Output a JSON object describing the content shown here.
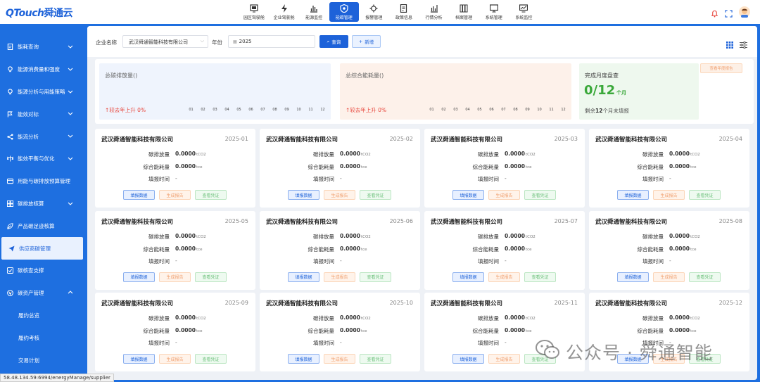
{
  "brand": {
    "logo_en": "QTouch",
    "logo_cn": "舜通云"
  },
  "nav": [
    {
      "label": "园区驾驶舱",
      "icon": "cockpit-icon"
    },
    {
      "label": "企业驾驶舱",
      "icon": "bolt-icon"
    },
    {
      "label": "能源监控",
      "icon": "bar-chart-icon"
    },
    {
      "label": "能碳管理",
      "icon": "carbon-shield-icon",
      "active": true
    },
    {
      "label": "报警管理",
      "icon": "alarm-gear-icon"
    },
    {
      "label": "政策信息",
      "icon": "document-edit-icon"
    },
    {
      "label": "行情分析",
      "icon": "market-chart-icon"
    },
    {
      "label": "档案管理",
      "icon": "archive-icon"
    },
    {
      "label": "系统管理",
      "icon": "monitor-icon"
    },
    {
      "label": "系统监控",
      "icon": "trend-monitor-icon"
    }
  ],
  "sidebar": [
    {
      "label": "能耗查询",
      "icon": "file-icon",
      "chevron": "down"
    },
    {
      "label": "能源消费量和强度",
      "icon": "bulb-icon",
      "chevron": "down"
    },
    {
      "label": "能源分析与用能策略",
      "icon": "bulb-icon",
      "chevron": "down"
    },
    {
      "label": "能效对标",
      "icon": "flag-icon",
      "chevron": "down"
    },
    {
      "label": "能流分析",
      "icon": "flow-icon",
      "chevron": "down"
    },
    {
      "label": "能效平衡与优化",
      "icon": "balance-icon",
      "chevron": "down"
    },
    {
      "label": "用能与碳排放预算管理",
      "icon": "budget-icon"
    },
    {
      "label": "碳排放核算",
      "icon": "grid-icon",
      "chevron": "down"
    },
    {
      "label": "产品碳足迹核算",
      "icon": "leaf-icon"
    },
    {
      "label": "供应商碳管理",
      "icon": "send-icon",
      "active": true
    },
    {
      "label": "碳核查支撑",
      "icon": "check-icon"
    },
    {
      "label": "碳资产管理",
      "icon": "asset-icon",
      "chevron": "up"
    },
    {
      "label": "履约总览",
      "sub": true
    },
    {
      "label": "履约考核",
      "sub": true
    },
    {
      "label": "交易计划",
      "sub": true
    }
  ],
  "filter": {
    "company_label": "企业名称",
    "company_value": "武汉舜通智能科技有限公司",
    "year_label": "年份",
    "year_value": "2025",
    "query_label": "查询",
    "add_label": "新增"
  },
  "summary": {
    "emission_title": "总碳排放量()",
    "emission_rise": "↑较去年上升 0%",
    "energy_title": "总综合能耗量()",
    "energy_rise": "↑较去年上升 0%",
    "months": [
      "01",
      "02",
      "03",
      "04",
      "05",
      "06",
      "07",
      "08",
      "09",
      "10",
      "11",
      "12"
    ],
    "month_progress_title": "完成月度盘查",
    "progress_value": "0/12",
    "progress_unit": "个月",
    "remaining_prefix": "剩余",
    "remaining_count": "12",
    "remaining_suffix": "个月未填报",
    "annual_report_button": "查看年度报告"
  },
  "card_labels": {
    "emission": "碳排放量",
    "energy": "综合能耗量",
    "report_time": "填报时间",
    "emission_unit": "tCO2",
    "energy_unit": "tce",
    "fill_button": "填报数据",
    "generate_button": "生成报告",
    "view_button": "查看凭证"
  },
  "cards": [
    {
      "company": "武汉舜通智能科技有限公司",
      "date": "2025-01",
      "emission": "0.0000",
      "energy": "0.0000",
      "report_time": "-"
    },
    {
      "company": "武汉舜通智能科技有限公司",
      "date": "2025-02",
      "emission": "0.0000",
      "energy": "0.0000",
      "report_time": "-"
    },
    {
      "company": "武汉舜通智能科技有限公司",
      "date": "2025-03",
      "emission": "0.0000",
      "energy": "0.0000",
      "report_time": "-"
    },
    {
      "company": "武汉舜通智能科技有限公司",
      "date": "2025-04",
      "emission": "0.0000",
      "energy": "0.0000",
      "report_time": "-"
    },
    {
      "company": "武汉舜通智能科技有限公司",
      "date": "2025-05",
      "emission": "0.0000",
      "energy": "0.0000",
      "report_time": "-"
    },
    {
      "company": "武汉舜通智能科技有限公司",
      "date": "2025-06",
      "emission": "0.0000",
      "energy": "0.0000",
      "report_time": "-"
    },
    {
      "company": "武汉舜通智能科技有限公司",
      "date": "2025-07",
      "emission": "0.0000",
      "energy": "0.0000",
      "report_time": "-"
    },
    {
      "company": "武汉舜通智能科技有限公司",
      "date": "2025-08",
      "emission": "0.0000",
      "energy": "0.0000",
      "report_time": "-"
    },
    {
      "company": "武汉舜通智能科技有限公司",
      "date": "2025-09",
      "emission": "0.0000",
      "energy": "0.0000",
      "report_time": "-"
    },
    {
      "company": "武汉舜通智能科技有限公司",
      "date": "2025-10",
      "emission": "0.0000",
      "energy": "0.0000",
      "report_time": "-"
    },
    {
      "company": "武汉舜通智能科技有限公司",
      "date": "2025-11",
      "emission": "0.0000",
      "energy": "0.0000",
      "report_time": "-"
    },
    {
      "company": "武汉舜通智能科技有限公司",
      "date": "2025-12",
      "emission": "0.0000",
      "energy": "0.0000",
      "report_time": "-"
    }
  ],
  "status_url": "58.48.134.59:6994/energyManage/supplier",
  "watermark": "公众号 · 舜通智能",
  "colors": {
    "primary": "#1d62d9",
    "rise": "#e8463c",
    "progress": "#3aa83a"
  }
}
